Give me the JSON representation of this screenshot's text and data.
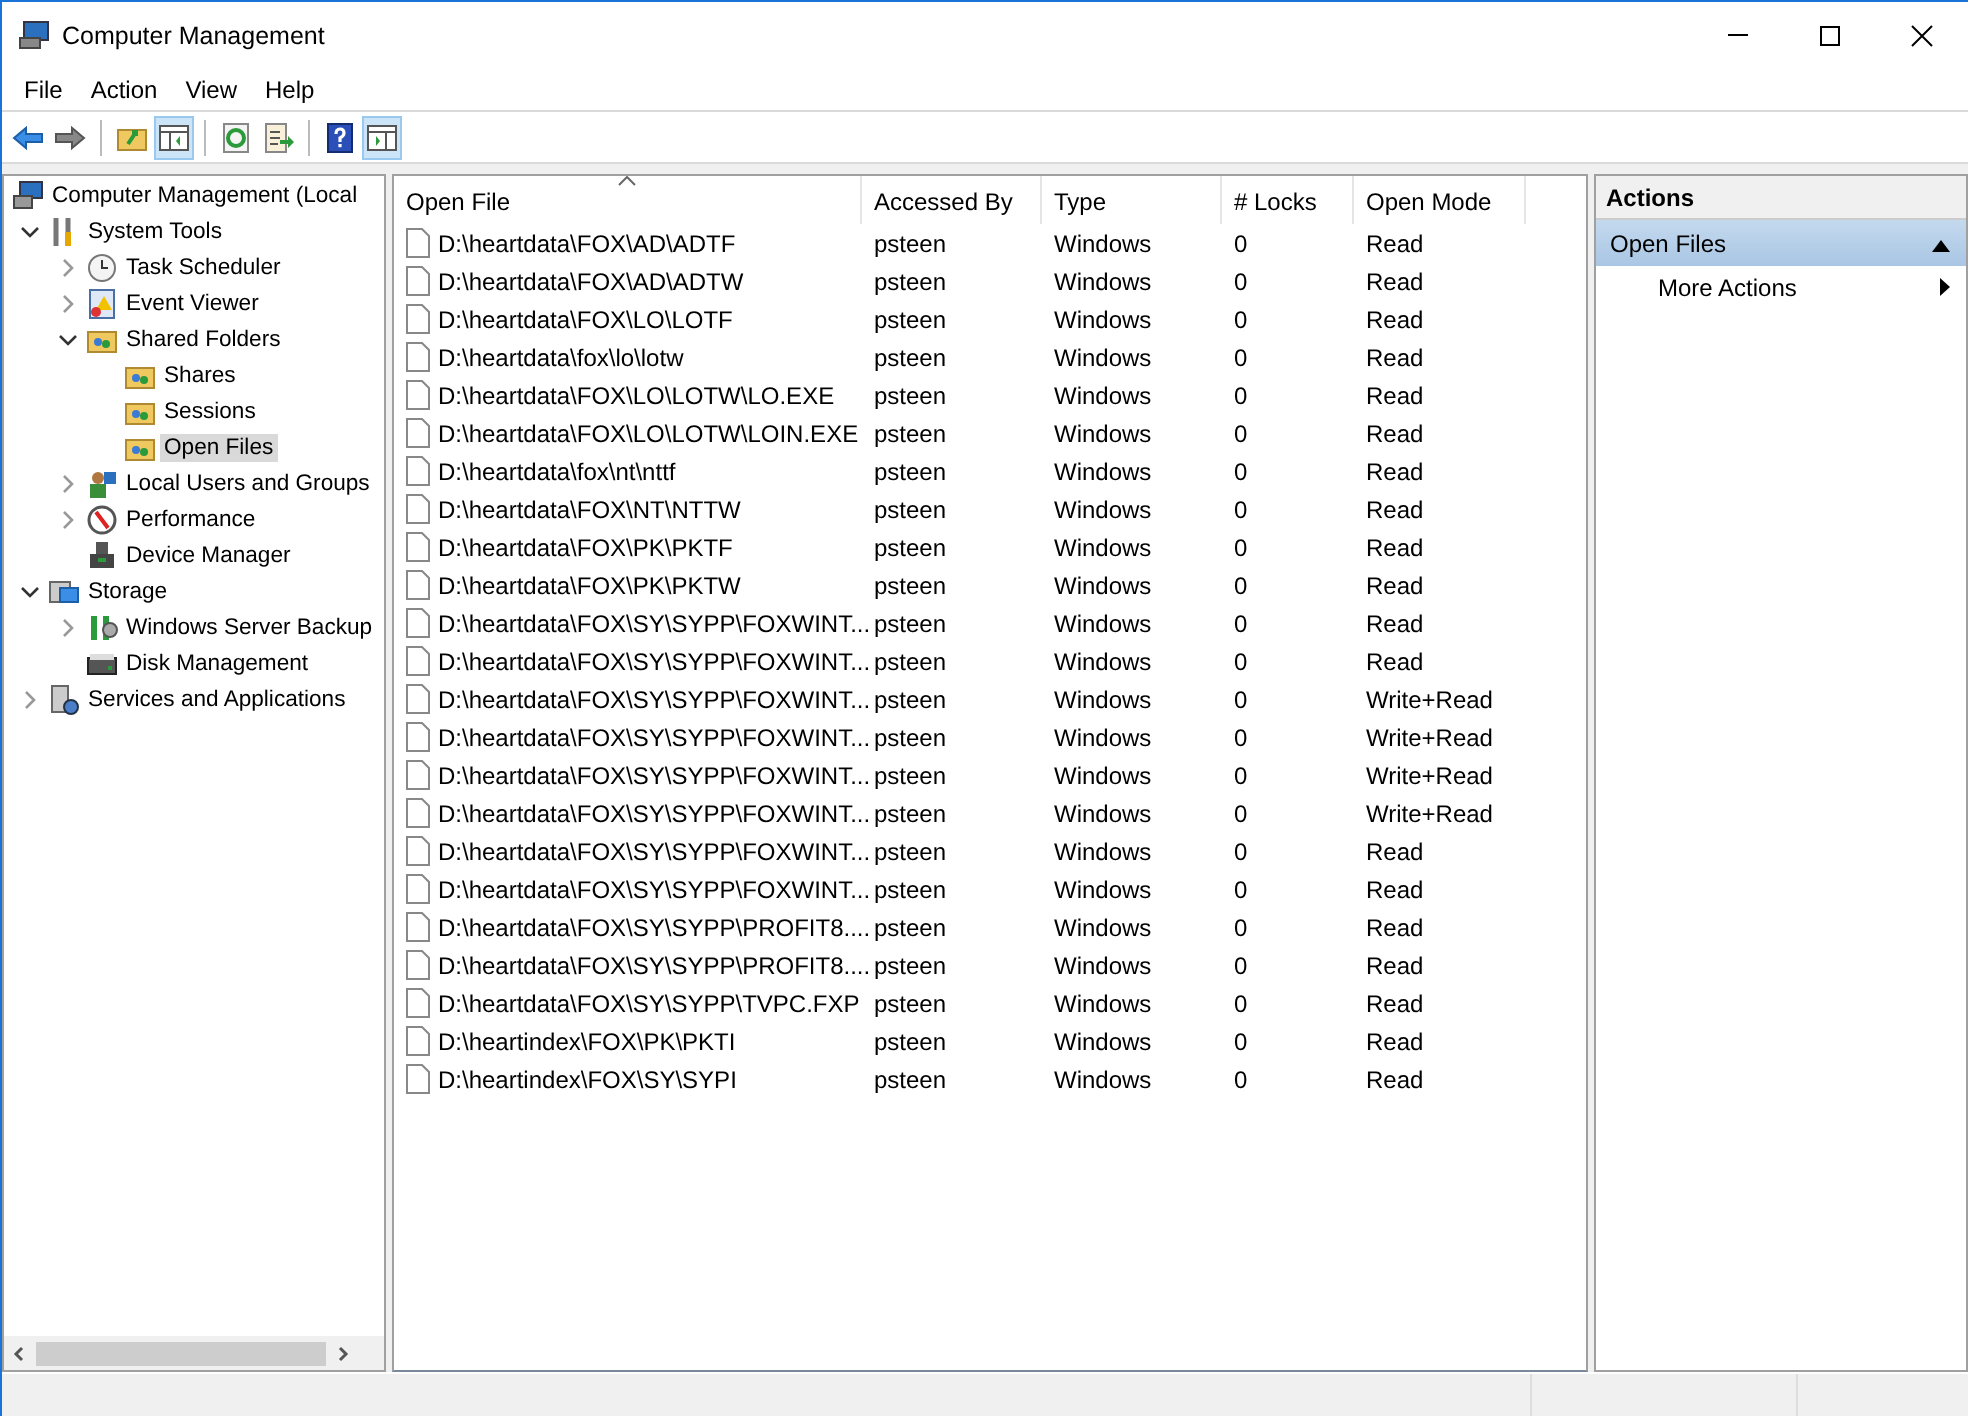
{
  "window": {
    "title": "Computer Management"
  },
  "menu": [
    "File",
    "Action",
    "View",
    "Help"
  ],
  "toolbar": [
    {
      "kind": "back",
      "pressed": false
    },
    {
      "kind": "forward",
      "pressed": false
    },
    {
      "kind": "sep"
    },
    {
      "kind": "up",
      "pressed": false
    },
    {
      "kind": "tree",
      "pressed": true
    },
    {
      "kind": "sep"
    },
    {
      "kind": "refresh",
      "pressed": false
    },
    {
      "kind": "export",
      "pressed": false
    },
    {
      "kind": "sep"
    },
    {
      "kind": "help",
      "pressed": false
    },
    {
      "kind": "pane",
      "pressed": true
    }
  ],
  "tree": [
    {
      "label": "Computer Management (Local",
      "kind": "computer",
      "selected": false,
      "children": [
        {
          "label": "System Tools",
          "kind": "tools",
          "selected": false,
          "expanded": true,
          "children": [
            {
              "label": "Task Scheduler",
              "kind": "clock",
              "selected": false,
              "expanded": false
            },
            {
              "label": "Event Viewer",
              "kind": "log",
              "selected": false,
              "expanded": false
            },
            {
              "label": "Shared Folders",
              "kind": "share",
              "selected": false,
              "expanded": true,
              "children": [
                {
                  "label": "Shares",
                  "kind": "share",
                  "selected": false
                },
                {
                  "label": "Sessions",
                  "kind": "share",
                  "selected": false
                },
                {
                  "label": "Open Files",
                  "kind": "share",
                  "selected": true
                }
              ]
            },
            {
              "label": "Local Users and Groups",
              "kind": "users",
              "selected": false,
              "expanded": false
            },
            {
              "label": "Performance",
              "kind": "gauge",
              "selected": false,
              "expanded": false
            },
            {
              "label": "Device Manager",
              "kind": "device",
              "selected": false
            }
          ]
        },
        {
          "label": "Storage",
          "kind": "storage",
          "selected": false,
          "expanded": true,
          "children": [
            {
              "label": "Windows Server Backup",
              "kind": "backup",
              "selected": false,
              "expanded": false
            },
            {
              "label": "Disk Management",
              "kind": "disk",
              "selected": false
            }
          ]
        },
        {
          "label": "Services and Applications",
          "kind": "services",
          "selected": false,
          "expanded": false
        }
      ]
    }
  ],
  "table": {
    "columns": [
      {
        "label": "Open File",
        "sorted": true
      },
      {
        "label": "Accessed By",
        "sorted": false
      },
      {
        "label": "Type",
        "sorted": false
      },
      {
        "label": "# Locks",
        "sorted": false
      },
      {
        "label": "Open Mode",
        "sorted": false
      }
    ],
    "rows": [
      [
        "D:\\heartdata\\FOX\\AD\\ADTF",
        "psteen",
        "Windows",
        "0",
        "Read"
      ],
      [
        "D:\\heartdata\\FOX\\AD\\ADTW",
        "psteen",
        "Windows",
        "0",
        "Read"
      ],
      [
        "D:\\heartdata\\FOX\\LO\\LOTF",
        "psteen",
        "Windows",
        "0",
        "Read"
      ],
      [
        "D:\\heartdata\\fox\\lo\\lotw",
        "psteen",
        "Windows",
        "0",
        "Read"
      ],
      [
        "D:\\heartdata\\FOX\\LO\\LOTW\\LO.EXE",
        "psteen",
        "Windows",
        "0",
        "Read"
      ],
      [
        "D:\\heartdata\\FOX\\LO\\LOTW\\LOIN.EXE",
        "psteen",
        "Windows",
        "0",
        "Read"
      ],
      [
        "D:\\heartdata\\fox\\nt\\nttf",
        "psteen",
        "Windows",
        "0",
        "Read"
      ],
      [
        "D:\\heartdata\\FOX\\NT\\NTTW",
        "psteen",
        "Windows",
        "0",
        "Read"
      ],
      [
        "D:\\heartdata\\FOX\\PK\\PKTF",
        "psteen",
        "Windows",
        "0",
        "Read"
      ],
      [
        "D:\\heartdata\\FOX\\PK\\PKTW",
        "psteen",
        "Windows",
        "0",
        "Read"
      ],
      [
        "D:\\heartdata\\FOX\\SY\\SYPP\\FOXWINT...",
        "psteen",
        "Windows",
        "0",
        "Read"
      ],
      [
        "D:\\heartdata\\FOX\\SY\\SYPP\\FOXWINT...",
        "psteen",
        "Windows",
        "0",
        "Read"
      ],
      [
        "D:\\heartdata\\FOX\\SY\\SYPP\\FOXWINT...",
        "psteen",
        "Windows",
        "0",
        "Write+Read"
      ],
      [
        "D:\\heartdata\\FOX\\SY\\SYPP\\FOXWINT...",
        "psteen",
        "Windows",
        "0",
        "Write+Read"
      ],
      [
        "D:\\heartdata\\FOX\\SY\\SYPP\\FOXWINT...",
        "psteen",
        "Windows",
        "0",
        "Write+Read"
      ],
      [
        "D:\\heartdata\\FOX\\SY\\SYPP\\FOXWINT...",
        "psteen",
        "Windows",
        "0",
        "Write+Read"
      ],
      [
        "D:\\heartdata\\FOX\\SY\\SYPP\\FOXWINT...",
        "psteen",
        "Windows",
        "0",
        "Read"
      ],
      [
        "D:\\heartdata\\FOX\\SY\\SYPP\\FOXWINT...",
        "psteen",
        "Windows",
        "0",
        "Read"
      ],
      [
        "D:\\heartdata\\FOX\\SY\\SYPP\\PROFIT8....",
        "psteen",
        "Windows",
        "0",
        "Read"
      ],
      [
        "D:\\heartdata\\FOX\\SY\\SYPP\\PROFIT8....",
        "psteen",
        "Windows",
        "0",
        "Read"
      ],
      [
        "D:\\heartdata\\FOX\\SY\\SYPP\\TVPC.FXP",
        "psteen",
        "Windows",
        "0",
        "Read"
      ],
      [
        "D:\\heartindex\\FOX\\PK\\PKTI",
        "psteen",
        "Windows",
        "0",
        "Read"
      ],
      [
        "D:\\heartindex\\FOX\\SY\\SYPI",
        "psteen",
        "Windows",
        "0",
        "Read"
      ]
    ]
  },
  "actions": {
    "title": "Actions",
    "sections": [
      {
        "title": "Open Files",
        "expanded": true,
        "items": [
          "More Actions"
        ]
      }
    ]
  }
}
